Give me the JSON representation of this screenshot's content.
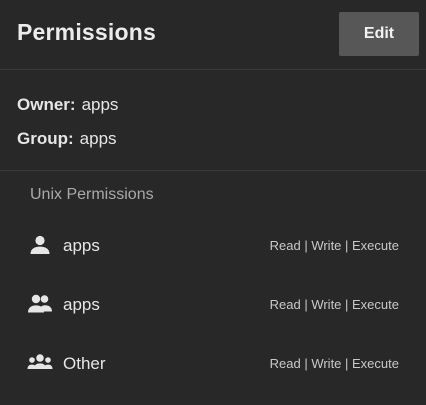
{
  "header": {
    "title": "Permissions",
    "edit_label": "Edit"
  },
  "owner": {
    "label": "Owner:",
    "value": "apps"
  },
  "group": {
    "label": "Group:",
    "value": "apps"
  },
  "unix": {
    "section_title": "Unix Permissions",
    "rows": [
      {
        "icon": "person-icon",
        "name": "apps",
        "rights": "Read | Write | Execute"
      },
      {
        "icon": "group-icon",
        "name": "apps",
        "rights": "Read | Write | Execute"
      },
      {
        "icon": "groups-icon",
        "name": "Other",
        "rights": "Read | Write | Execute"
      }
    ]
  },
  "colors": {
    "background": "#282828",
    "button": "#575757",
    "text": "#e6e6e6",
    "muted": "#a9a9a9"
  }
}
